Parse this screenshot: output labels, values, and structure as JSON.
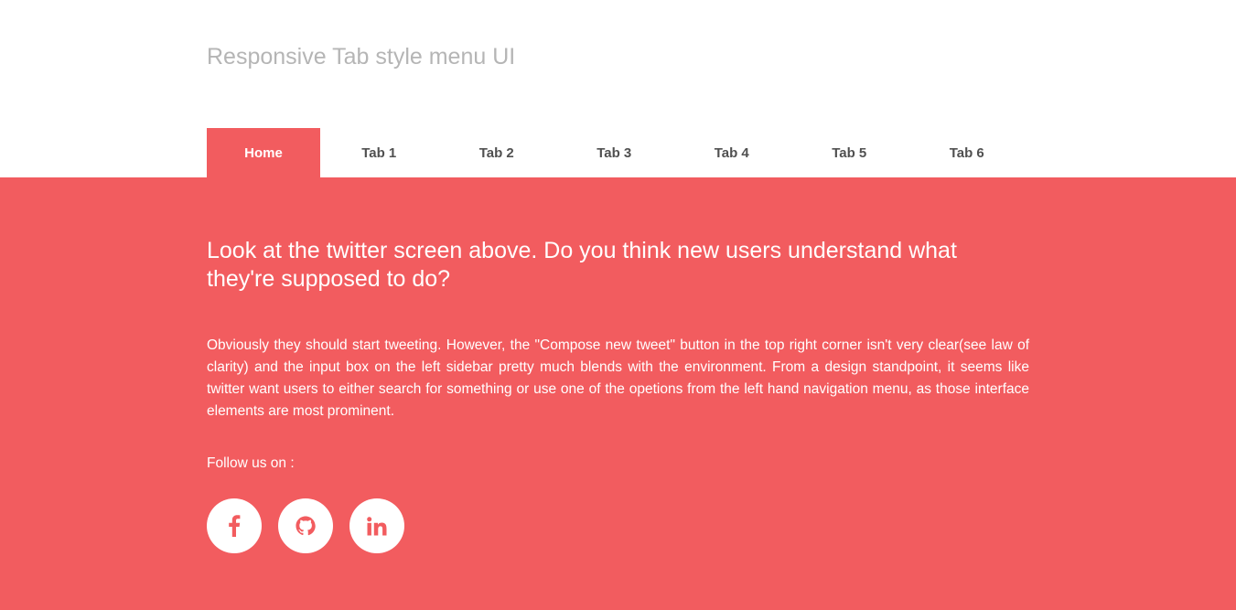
{
  "header": {
    "title": "Responsive Tab style menu UI"
  },
  "tabs": [
    {
      "label": "Home",
      "active": true
    },
    {
      "label": "Tab 1",
      "active": false
    },
    {
      "label": "Tab 2",
      "active": false
    },
    {
      "label": "Tab 3",
      "active": false
    },
    {
      "label": "Tab 4",
      "active": false
    },
    {
      "label": "Tab 5",
      "active": false
    },
    {
      "label": "Tab 6",
      "active": false
    }
  ],
  "content": {
    "headline": "Look at the twitter screen above. Do you think new users understand what they're supposed to do?",
    "body": "Obviously they should start tweeting. However, the \"Compose new tweet\" button in the top right corner isn't very clear(see law of clarity) and the input box on the left sidebar pretty much blends with the environment. From a design standpoint, it seems like twitter want users to either search for something or use one of the opetions from the left hand navigation menu, as those interface elements are most prominent.",
    "follow_label": "Follow us on :",
    "socials": [
      {
        "icon": "facebook-icon"
      },
      {
        "icon": "github-icon"
      },
      {
        "icon": "linkedin-icon"
      }
    ]
  },
  "colors": {
    "accent": "#f25c5f",
    "title": "#b5b5b5",
    "tab_text": "#505050",
    "white": "#ffffff"
  }
}
